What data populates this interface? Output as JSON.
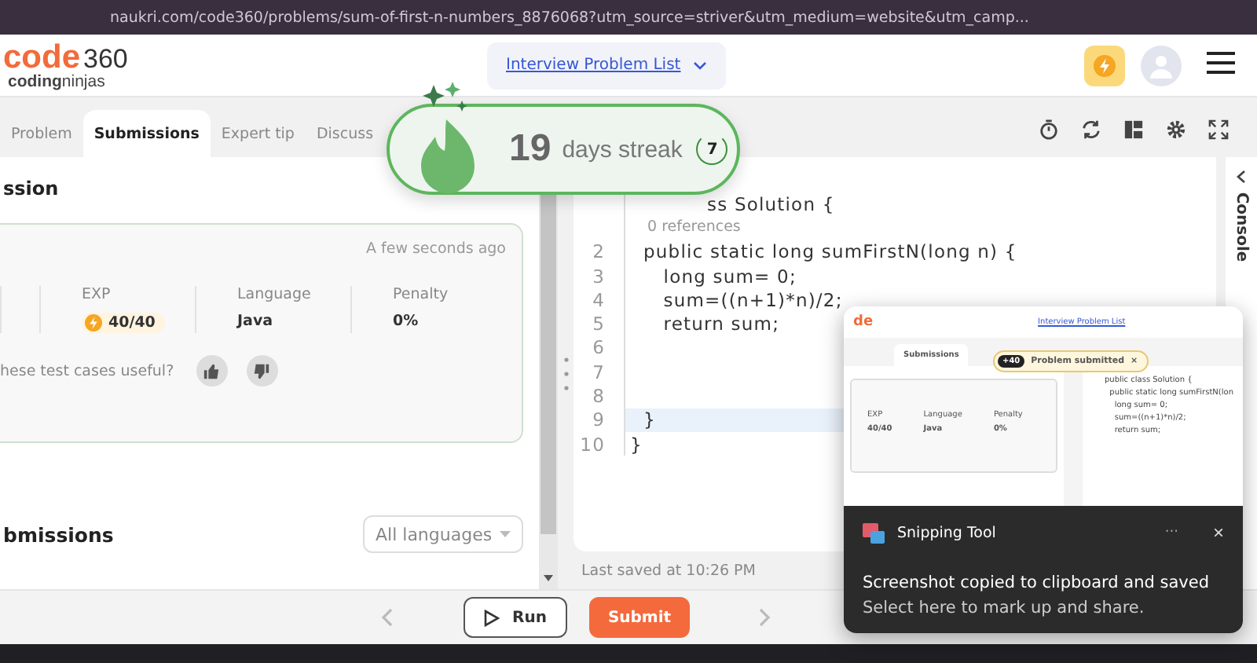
{
  "browser": {
    "url": "naukri.com/code360/problems/sum-of-first-n-numbers_8876068?utm_source=striver&utm_medium=website&utm_camp..."
  },
  "header": {
    "logo": {
      "brand": "code",
      "number": "360",
      "tagline_bold": "coding",
      "tagline": "ninjas"
    },
    "nav_dropdown": "Interview Problem List"
  },
  "tabs": [
    {
      "label": "Problem",
      "selected": false
    },
    {
      "label": "Submissions",
      "selected": true
    },
    {
      "label": "Expert tip",
      "selected": false
    },
    {
      "label": "Discuss",
      "selected": false
    }
  ],
  "submission": {
    "heading": "ssion",
    "time": "A few seconds ago",
    "stats": [
      {
        "label": "EXP",
        "value": "40/40",
        "kind": "exp"
      },
      {
        "label": "Language",
        "value": "Java",
        "kind": "plain"
      },
      {
        "label": "Penalty",
        "value": "0%",
        "kind": "plain"
      }
    ],
    "feedback_question": "hese test cases useful?"
  },
  "submissions_list": {
    "heading": "bmissions",
    "language_filter": "All languages"
  },
  "editor": {
    "lines": [
      {
        "kind": "covered",
        "text": "ss Solution {",
        "current": false
      },
      {
        "kind": "codelens",
        "text": "0 references",
        "current": false
      },
      {
        "number": "2",
        "kind": "code",
        "text": "  public static long sumFirstN(long n) {",
        "current": false
      },
      {
        "number": "3",
        "kind": "code",
        "text": "     long sum= 0;",
        "current": false
      },
      {
        "number": "4",
        "kind": "code",
        "text": "     sum=((n+1)*n)/2;",
        "current": false
      },
      {
        "number": "5",
        "kind": "code",
        "text": "     return sum;",
        "current": false
      },
      {
        "number": "6",
        "kind": "code",
        "current": false
      },
      {
        "number": "7",
        "kind": "code",
        "current": false
      },
      {
        "number": "8",
        "kind": "code",
        "current": false
      },
      {
        "number": "9",
        "kind": "code",
        "text": "  }",
        "current": true
      },
      {
        "number": "10",
        "kind": "code",
        "text": "}",
        "current": false
      }
    ],
    "status": "Last saved at 10:26 PM"
  },
  "console": {
    "label": "Console"
  },
  "footer_buttons": [
    {
      "label": "Run",
      "kind": "run"
    },
    {
      "label": "Submit",
      "kind": "submit"
    }
  ],
  "streak": {
    "count": "19",
    "label": "days streak",
    "badge": "7"
  },
  "notification": {
    "app": "Snipping Tool",
    "menu": "···",
    "close": "×",
    "title": "Screenshot copied to clipboard and saved",
    "message": "Select here to mark up and share.",
    "thumbnail": {
      "logo": "de",
      "nav": "Interview Problem List",
      "tab": "Submissions",
      "toast": {
        "points": "+40",
        "text": "Problem submitted",
        "close": "×"
      },
      "stats": [
        {
          "label": "EXP",
          "value": "40/40"
        },
        {
          "label": "Language",
          "value": "Java"
        },
        {
          "label": "Penalty",
          "value": "0%"
        }
      ],
      "code": [
        "public class Solution {",
        "  public static long sumFirstN(lon",
        "    long sum= 0;",
        "    sum=((n+1)*n)/2;",
        "    return sum;"
      ]
    }
  }
}
